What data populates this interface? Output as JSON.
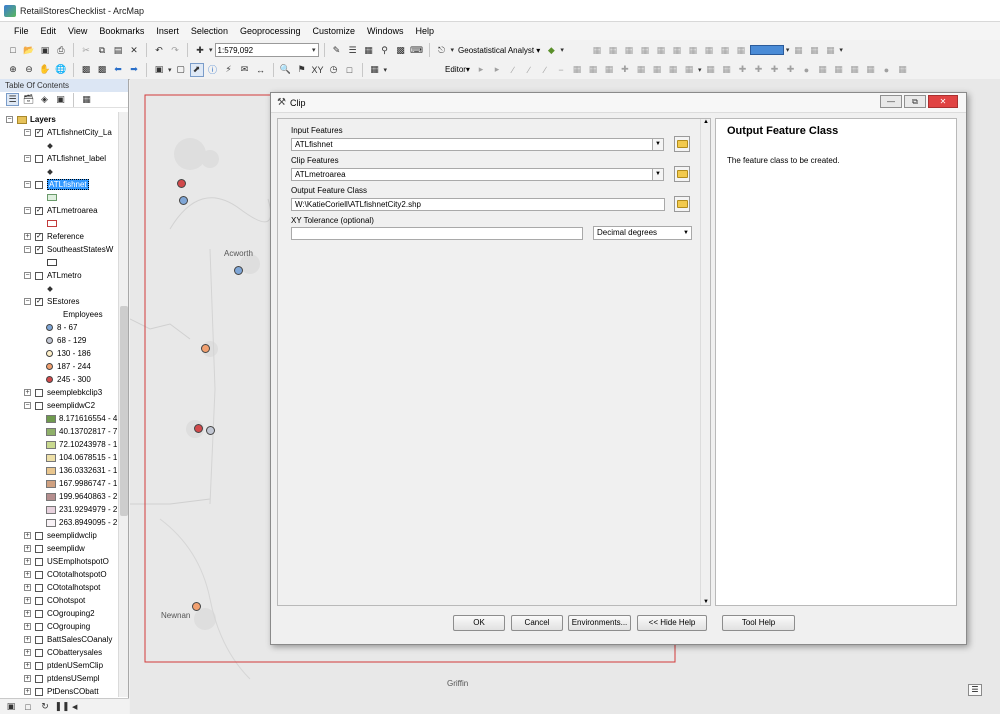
{
  "window": {
    "title": "RetailStoresChecklist - ArcMap"
  },
  "menu": [
    "File",
    "Edit",
    "View",
    "Bookmarks",
    "Insert",
    "Selection",
    "Geoprocessing",
    "Customize",
    "Windows",
    "Help"
  ],
  "toolbar": {
    "scale": "1:579,092",
    "geostatistical_label": "Geostatistical Analyst ▾",
    "editor_label": "Editor▾"
  },
  "toc": {
    "title": "Table Of Contents",
    "layers_root": "Layers",
    "layers": [
      {
        "label": "ATLfishnetCity_La",
        "checked": true,
        "expanded": true
      },
      {
        "label": "ATLfishnet_label",
        "checked": false,
        "expanded": true
      },
      {
        "label": "ATLfishnet",
        "checked": false,
        "expanded": true,
        "selected": true
      },
      {
        "label": "ATLmetroarea",
        "checked": true,
        "expanded": true
      },
      {
        "label": "Reference",
        "checked": true,
        "expanded": false
      },
      {
        "label": "SoutheastStatesW",
        "checked": true,
        "expanded": true
      },
      {
        "label": "ATLmetro",
        "checked": false,
        "expanded": true
      },
      {
        "label": "SEstores",
        "checked": true,
        "expanded": true
      },
      {
        "label": "seemplebkclip3",
        "checked": false,
        "expanded": false
      },
      {
        "label": "seemplidwC2",
        "checked": false,
        "expanded": true
      },
      {
        "label": "seemplidwclip",
        "checked": false,
        "expanded": false
      },
      {
        "label": "seemplidw",
        "checked": false,
        "expanded": false
      },
      {
        "label": "USEmplhotspotO",
        "checked": false,
        "expanded": false
      },
      {
        "label": "COtotalhotspotO",
        "checked": false,
        "expanded": false
      },
      {
        "label": "COtotalhotspot",
        "checked": false,
        "expanded": false
      },
      {
        "label": "COhotspot",
        "checked": false,
        "expanded": false
      },
      {
        "label": "COgrouping2",
        "checked": false,
        "expanded": false
      },
      {
        "label": "COgrouping",
        "checked": false,
        "expanded": false
      },
      {
        "label": "BattSalesCOanaly",
        "checked": false,
        "expanded": false
      },
      {
        "label": "CObatterysales",
        "checked": false,
        "expanded": false
      },
      {
        "label": "ptdenUSemClip",
        "checked": false,
        "expanded": false
      },
      {
        "label": "ptdensUSempl",
        "checked": false,
        "expanded": false
      },
      {
        "label": "PtDensCObatt",
        "checked": false,
        "expanded": false
      }
    ],
    "employees_heading": "Employees",
    "employees_classes": [
      {
        "label": "8 - 67",
        "color": "#7fa6d6"
      },
      {
        "label": "68 - 129",
        "color": "#c2c7d3"
      },
      {
        "label": "130 - 186",
        "color": "#fff0c8"
      },
      {
        "label": "187 - 244",
        "color": "#f1a070"
      },
      {
        "label": "245 - 300",
        "color": "#d1494b"
      }
    ],
    "raster_classes": [
      {
        "label": "8.171616554 - 4",
        "color": "#6f9a4e"
      },
      {
        "label": "40.13702817 - 7",
        "color": "#8fb06a"
      },
      {
        "label": "72.10243978 - 1",
        "color": "#c9d98f"
      },
      {
        "label": "104.0678515 - 1",
        "color": "#eee0a8"
      },
      {
        "label": "136.0332631 - 1",
        "color": "#e9c68e"
      },
      {
        "label": "167.9986747 - 1",
        "color": "#cfa080"
      },
      {
        "label": "199.9640863 - 2",
        "color": "#b58e8e"
      },
      {
        "label": "231.9294979 - 2",
        "color": "#e8d2de"
      },
      {
        "label": "263.8949095 - 2",
        "color": "#f8f2f6"
      }
    ]
  },
  "map": {
    "labels": [
      "Acworth",
      "Newnan",
      "Griffin"
    ]
  },
  "dialog": {
    "title": "Clip",
    "input_features_label": "Input Features",
    "input_features_value": "ATLfishnet",
    "clip_features_label": "Clip Features",
    "clip_features_value": "ATLmetroarea",
    "output_label": "Output Feature Class",
    "output_value": "W:\\KatieCoriell\\ATLfishnetCity2.shp",
    "xy_label": "XY Tolerance (optional)",
    "xy_value": "",
    "xy_units": "Decimal degrees",
    "buttons": {
      "ok": "OK",
      "cancel": "Cancel",
      "environments": "Environments...",
      "hide_help": "<< Hide Help",
      "tool_help": "Tool Help"
    },
    "help_title": "Output Feature Class",
    "help_text": "The feature class to be created."
  }
}
